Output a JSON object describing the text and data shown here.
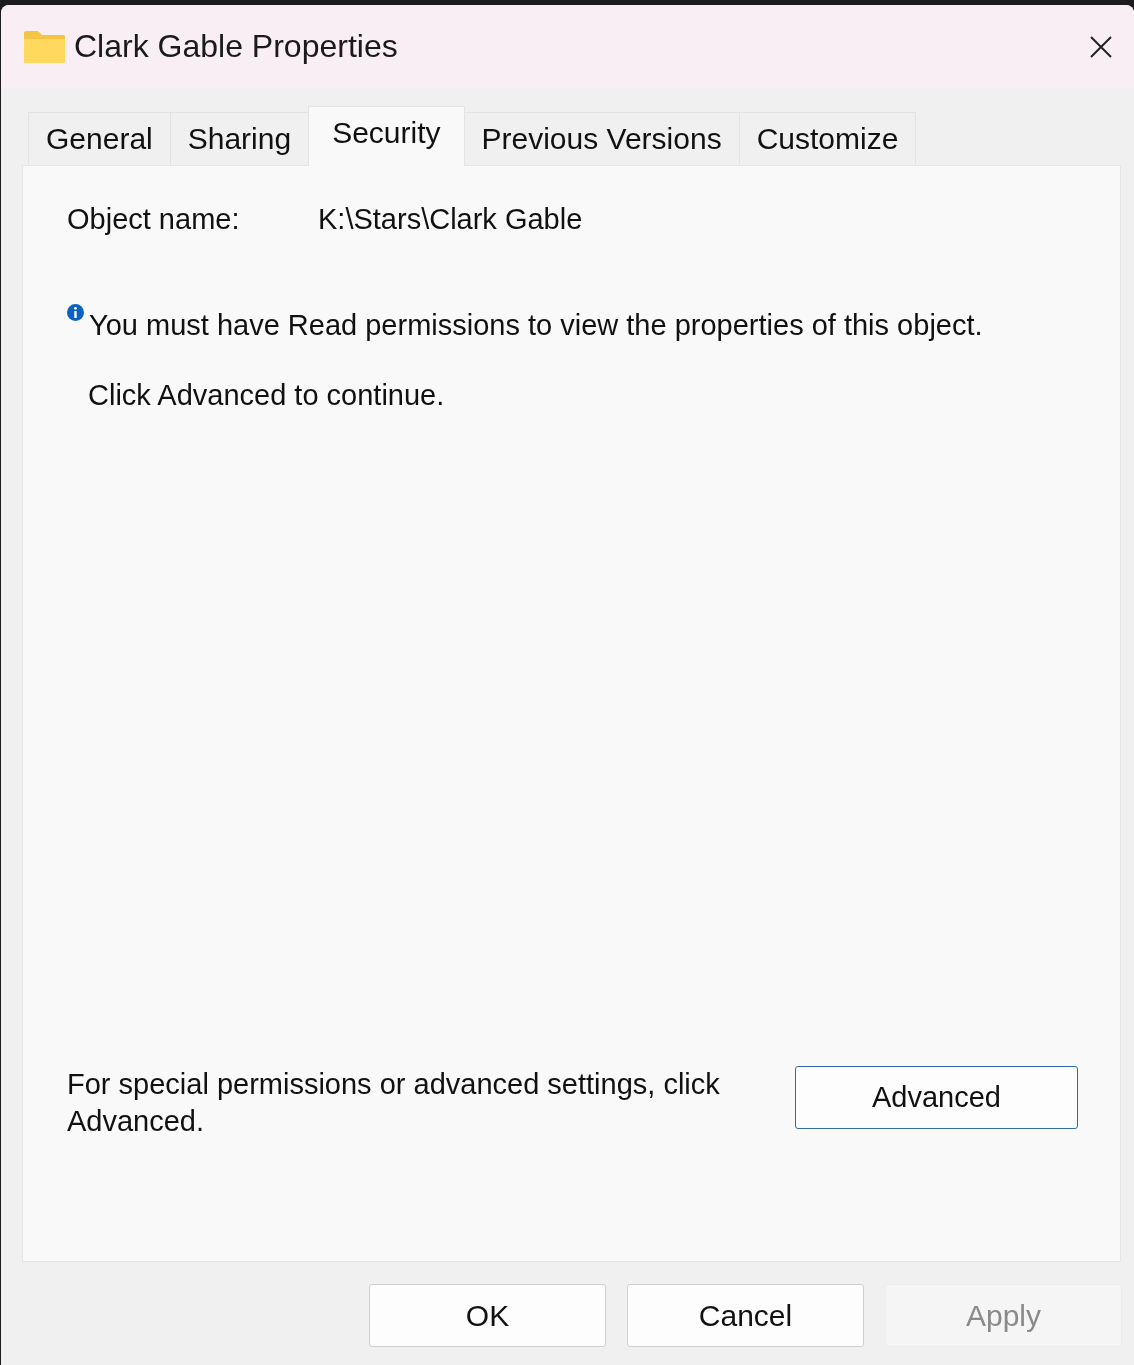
{
  "window": {
    "title": "Clark Gable Properties"
  },
  "tabs": [
    {
      "label": "General",
      "selected": false
    },
    {
      "label": "Sharing",
      "selected": false
    },
    {
      "label": "Security",
      "selected": true
    },
    {
      "label": "Previous Versions",
      "selected": false
    },
    {
      "label": "Customize",
      "selected": false
    }
  ],
  "object_name": {
    "label": "Object name:",
    "value": "K:\\Stars\\Clark Gable"
  },
  "message": {
    "text": "You must have Read permissions to view the properties of this object.",
    "hint": "Click Advanced to continue."
  },
  "advanced": {
    "text": "For special permissions or advanced settings, click Advanced.",
    "button": "Advanced"
  },
  "buttons": [
    {
      "label": "OK",
      "disabled": false
    },
    {
      "label": "Cancel",
      "disabled": false
    },
    {
      "label": "Apply",
      "disabled": true
    }
  ]
}
